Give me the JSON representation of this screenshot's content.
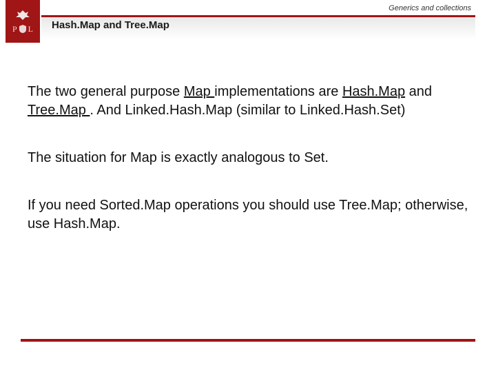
{
  "header": {
    "topic": "Generics and collections",
    "title": "Hash.Map and Tree.Map",
    "logo": {
      "p": "P",
      "l": "L"
    }
  },
  "body": {
    "p1_a": "The two general purpose ",
    "p1_link_map": "Map ",
    "p1_b": "implementations are ",
    "p1_link_hash": "Hash.Map",
    "p1_c": " and ",
    "p1_link_tree": "Tree.Map ",
    "p1_d": ". And Linked.Hash.Map (similar to Linked.Hash.Set)",
    "p2": "The situation for Map is exactly analogous to Set.",
    "p3": "If you need Sorted.Map operations you should use  Tree.Map; otherwise, use Hash.Map."
  }
}
